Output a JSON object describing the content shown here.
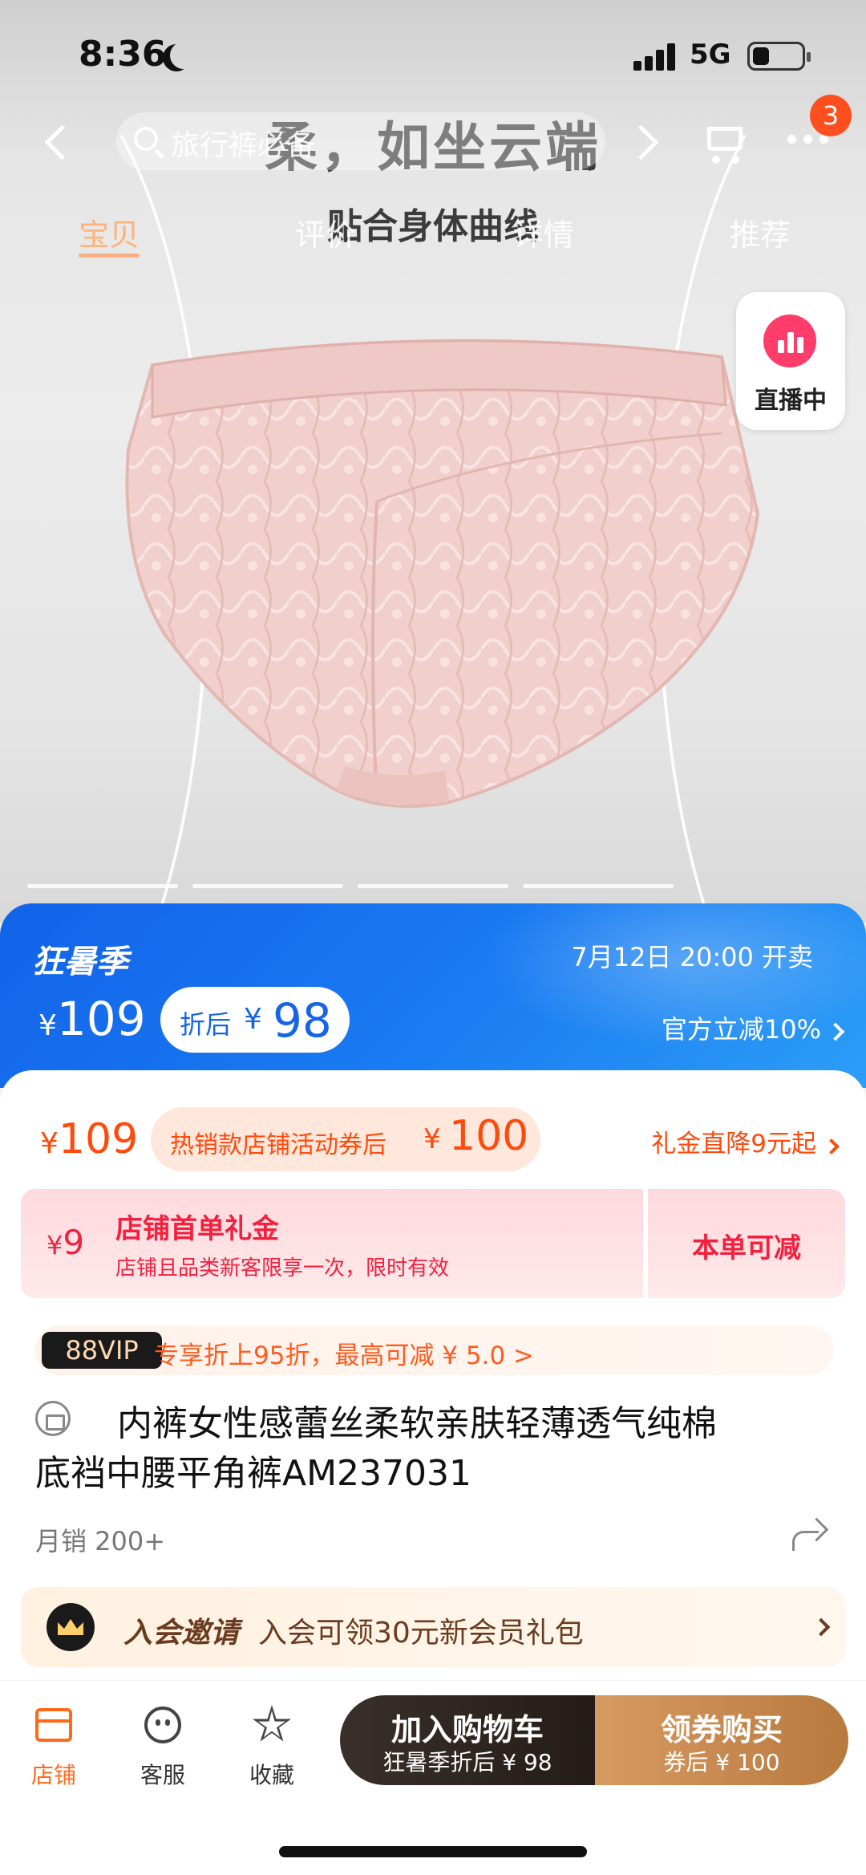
{
  "status_bar": {
    "time": "8:36",
    "network": "5G",
    "battery_fraction": 0.35
  },
  "nav": {
    "search_placeholder": "旅行裤必备",
    "cart_badge": "3",
    "tabs": [
      {
        "label": "宝贝",
        "active": true
      },
      {
        "label": "评价",
        "active": false
      },
      {
        "label": "详情",
        "active": false
      },
      {
        "label": "推荐",
        "active": false
      }
    ]
  },
  "hero": {
    "headline": "柔，如坐云端",
    "subline": "贴合身体曲线",
    "live_label": "直播中",
    "carousel_count": 4,
    "carousel_active": 0
  },
  "promo": {
    "title": "狂暑季",
    "date": "7月12日 20:00 开卖",
    "currency": "¥",
    "price": "109",
    "after_label": "折后",
    "after_price": "98",
    "discount_text": "官方立减10%"
  },
  "price_row": {
    "currency": "¥",
    "price": "109",
    "coupon_text": "热销款店铺活动券后",
    "coupon_price": "100",
    "gift_link": "礼金直降9元起"
  },
  "coupon": {
    "currency": "¥",
    "amount": "9",
    "title": "店铺首单礼金",
    "desc": "店铺且品类新客限享一次，限时有效",
    "apply": "本单可减"
  },
  "vip": {
    "badge": "88VIP",
    "text": "专享折上95折，最高可减 ¥ 5.0 >"
  },
  "product": {
    "title_line1": "内裤女性感蕾丝柔软亲肤轻薄透气纯棉",
    "title_line2": "底裆中腰平角裤AM237031",
    "sales": "月销 200+"
  },
  "member": {
    "title": "入会邀请",
    "desc": "入会可领30元新会员礼包"
  },
  "bottom_bar": {
    "shop": "店铺",
    "service": "客服",
    "favorite": "收藏",
    "cart_main": "加入购物车",
    "cart_sub": "狂暑季折后 ¥ 98",
    "buy_main": "领券购买",
    "buy_sub": "券后 ¥ 100"
  },
  "colors": {
    "accent_orange": "#ff4a0c",
    "promo_blue": "#1a6cf0",
    "coupon_red": "#f2213f",
    "live_pink": "#ff3d6b",
    "buy_gold": "#c98a4f",
    "cart_dark": "#2e2520"
  }
}
